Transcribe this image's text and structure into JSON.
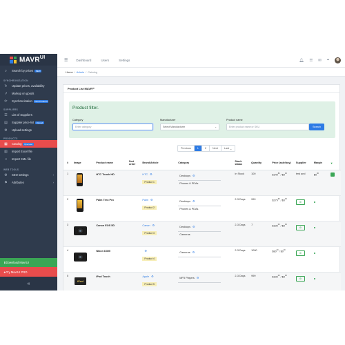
{
  "sidebar": {
    "brand": "MAVR",
    "brand_sup": "UI",
    "search_by_prices": "Search by prices",
    "search_badge": "NEW",
    "sync_head": "SYNCHRONIZATION",
    "update_prices": "Update prices, availability",
    "markup": "Markup on goods",
    "synchronization": "Synchronization",
    "sync_badge": "New Products",
    "suppliers_head": "SUPPLIERS",
    "list_suppliers": "List of Suppliers",
    "supplier_pricelist": "Supplier price-list",
    "supplier_badge": "Upload",
    "upload_settings": "Upload settings",
    "products_head": "PRODUCTS",
    "catalog": "Catalog",
    "catalog_badge": "Opencart",
    "import_excel": "Import Excel file",
    "import_xml": "Import XML file",
    "web_tools_head": "WEB TOOLS",
    "seo_settings": "SEO settings",
    "attributes": "Attributes",
    "download": "Download MavrUI",
    "try_pro": "Try MavrUI PRO",
    "collapse": "«",
    "colors": {
      "bg": "#2f3b4d",
      "active": "#e84c4c",
      "download": "#3aa655"
    }
  },
  "topbar": {
    "dashboard": "Dashboard",
    "users": "Users",
    "settings": "Settings"
  },
  "breadcrumb": {
    "home": "Home",
    "admin": "Admin",
    "catalog": "Catalog"
  },
  "card": {
    "title": "Product List MAVR",
    "title_sup": "UI"
  },
  "filter": {
    "title": "Product filter.",
    "category_label": "Category",
    "category_placeholder": "Enter category",
    "manufacturer_label": "Manufacturer",
    "manufacturer_value": "Select Manufacturer",
    "name_label": "Product name",
    "name_placeholder": "Enter product name or SKU",
    "search": "Search"
  },
  "pagination": {
    "previous": "Previous",
    "page1": "1",
    "page2": "2",
    "next": "Next",
    "last": "Last"
  },
  "table": {
    "headers": {
      "num": "#",
      "image": "Image",
      "name": "Product name",
      "sort": "Sort order",
      "brand": "Brand/Article",
      "category": "Category",
      "stock": "Stock status",
      "qty": "Quantity",
      "price": "Price (sale/buy)",
      "supplier": "Supplier",
      "margin": "Margin"
    },
    "rows": [
      {
        "num": "1",
        "name": "HTC Touch HD",
        "brand": "HTC",
        "tag": "Product 1",
        "cat1": "Desktops",
        "cat2": "Phones & PDAs",
        "stock": "In Stock",
        "qty": "100",
        "price1": "$149",
        "price1_sup": "80",
        "price2": "$0",
        "price2_sup": "00",
        "supplier": "test and",
        "margin": "$0",
        "margin_sup": "00"
      },
      {
        "num": "2",
        "name": "Palm Treo Pro",
        "brand": "Palm",
        "tag": "Product 2",
        "cat1": "Desktops",
        "cat2": "Phones & PDAs",
        "stock": "2-3 Days",
        "qty": "999",
        "price1": "$279",
        "price1_sup": "99",
        "price2": "$0",
        "price2_sup": "00",
        "supplier": "",
        "margin": ""
      },
      {
        "num": "3",
        "name": "Canon EOS 5D",
        "brand": "Canon",
        "tag": "Product 3",
        "cat1": "Desktops",
        "cat2": "Cameras",
        "stock": "2-3 Days",
        "qty": "7",
        "price1": "$100",
        "price1_sup": "00",
        "price2": "$0",
        "price2_sup": "00",
        "supplier": "",
        "margin": ""
      },
      {
        "num": "4",
        "name": "Nikon D300",
        "brand": "",
        "tag": "Product 4",
        "cat1": "Cameras",
        "cat2": "",
        "stock": "2-3 Days",
        "qty": "1000",
        "price1": "$80",
        "price1_sup": "00",
        "price2": "$0",
        "price2_sup": "00",
        "supplier": "",
        "margin": ""
      },
      {
        "num": "5",
        "name": "iPod Touch",
        "brand": "Apple",
        "tag": "Product 5",
        "cat1": "MP3 Players",
        "cat2": "",
        "stock": "2-3 Days",
        "qty": "999",
        "price1": "$100",
        "price1_sup": "00",
        "price2": "$0",
        "price2_sup": "00",
        "supplier": "",
        "margin": ""
      }
    ]
  }
}
